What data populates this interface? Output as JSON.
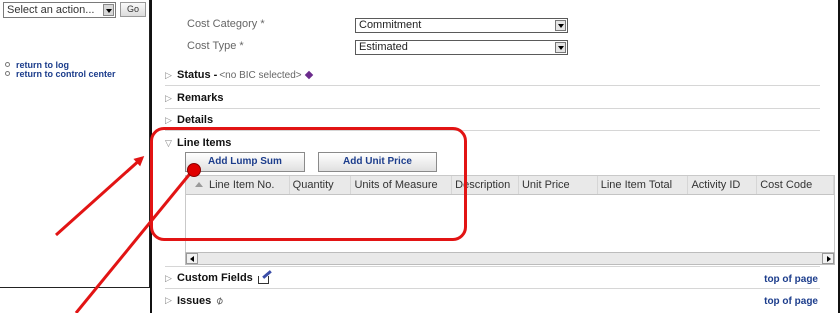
{
  "sidebar": {
    "action_select": "Select an action...",
    "go_label": "Go",
    "links": [
      "return to log",
      "return to control center"
    ]
  },
  "form": {
    "cost_category_label": "Cost Category *",
    "cost_category_value": "Commitment",
    "cost_type_label": "Cost Type *",
    "cost_type_value": "Estimated"
  },
  "sections": {
    "status_label": "Status -",
    "status_note": "<no BIC selected>",
    "remarks": "Remarks",
    "details": "Details",
    "line_items": "Line Items",
    "custom_fields": "Custom Fields",
    "issues": "Issues",
    "top_of_page": "top of page"
  },
  "line_items": {
    "add_lump_sum": "Add Lump Sum",
    "add_unit_price": "Add Unit Price",
    "columns": [
      "Line Item No.",
      "Quantity",
      "Units of Measure",
      "Description",
      "Unit Price",
      "Line Item Total",
      "Activity ID",
      "Cost Code"
    ]
  },
  "colors": {
    "link": "#1c3d8c",
    "annotation": "#e21414",
    "status_diamond": "#6b2b8c"
  }
}
